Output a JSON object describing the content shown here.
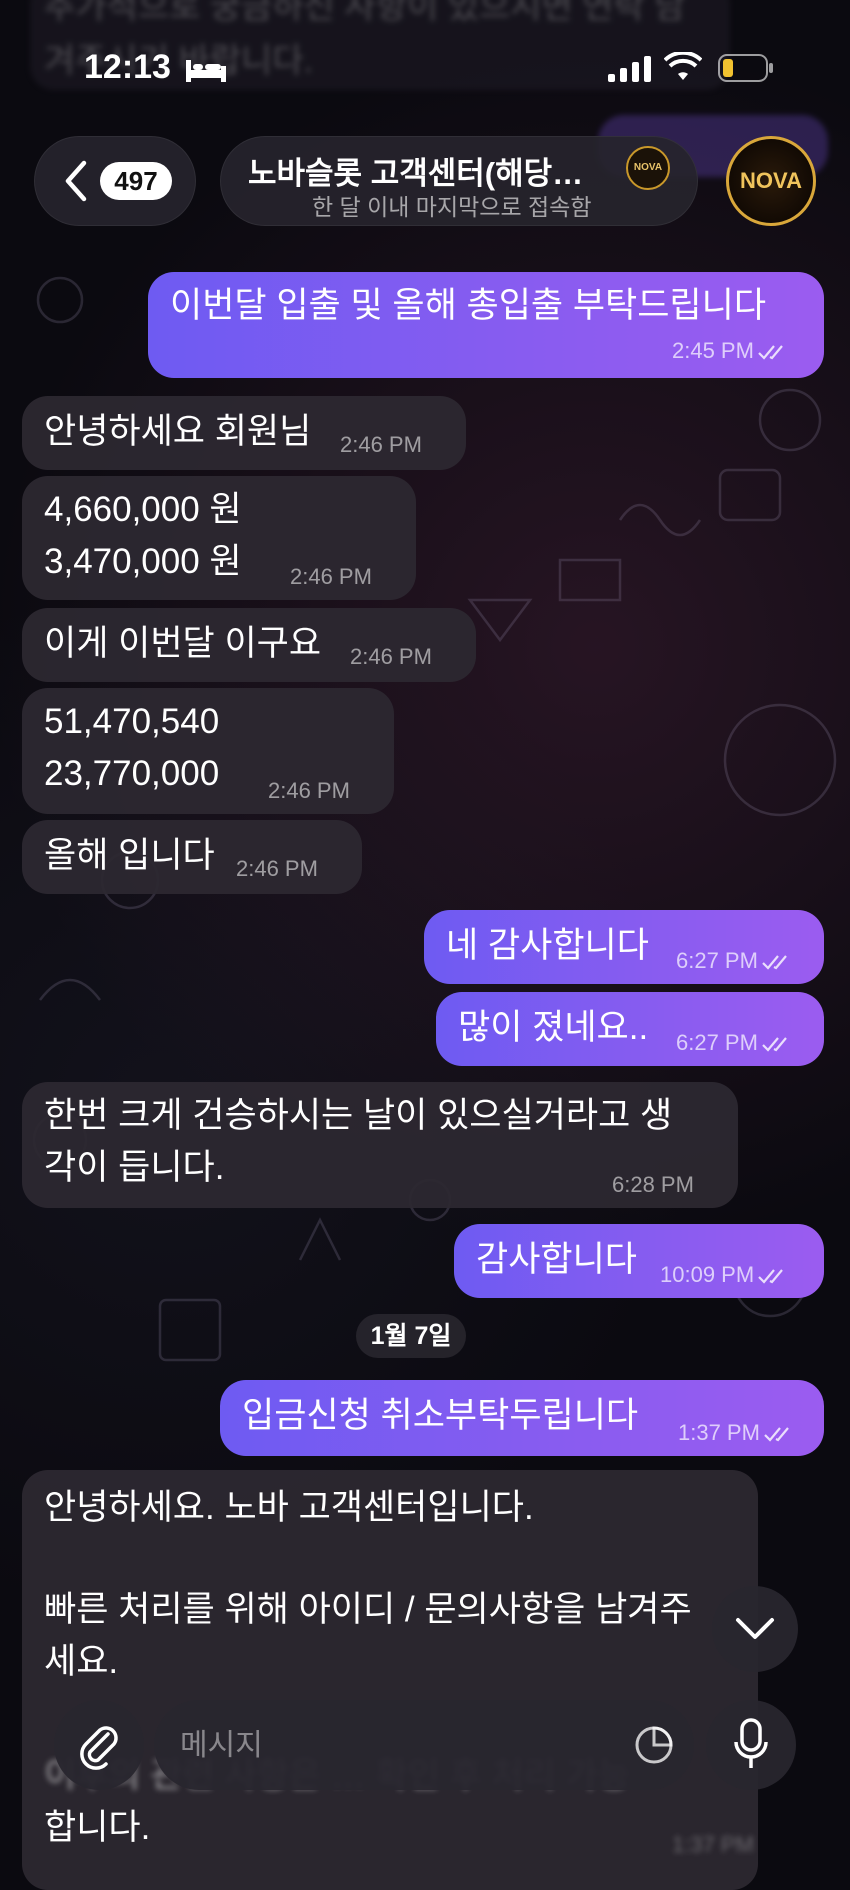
{
  "status_bar": {
    "time": "12:13"
  },
  "header": {
    "back_count": "497",
    "chat_title": "노바슬롯 고객센터(해당…",
    "chat_subtitle": "한 달 이내 마지막으로 접속함",
    "logo_text": "NOVA",
    "avatar_text": "NOVA"
  },
  "background_ghost": {
    "top_text": "추가적으로 궁금하신 사항이 있으시면 연락 남겨주시기 바랍니다."
  },
  "messages": [
    {
      "dir": "out",
      "text": "이번달 입출 및 올해 총입출 부탁드립니다",
      "time": "2:45 PM"
    },
    {
      "dir": "in",
      "text": "안녕하세요 회원님",
      "time": "2:46 PM"
    },
    {
      "dir": "in",
      "line1": "4,660,000 원",
      "line2": "3,470,000 원",
      "time": "2:46 PM"
    },
    {
      "dir": "in",
      "text": "이게 이번달 이구요",
      "time": "2:46 PM"
    },
    {
      "dir": "in",
      "line1": "51,470,540",
      "line2": "23,770,000",
      "time": "2:46 PM"
    },
    {
      "dir": "in",
      "text": "올해 입니다",
      "time": "2:46 PM"
    },
    {
      "dir": "out",
      "text": "네 감사합니다",
      "time": "6:27 PM"
    },
    {
      "dir": "out",
      "text": "많이 졌네요..",
      "time": "6:27 PM"
    },
    {
      "dir": "in",
      "line1": "한번 크게 건승하시는 날이 있으실거라고 생",
      "line2": "각이 듭니다.",
      "time": "6:28 PM"
    },
    {
      "dir": "out",
      "text": "감사합니다",
      "time": "10:09 PM"
    },
    {
      "dir": "out",
      "text": "입금신청 취소부탁두립니다",
      "time": "1:37 PM"
    },
    {
      "dir": "in",
      "line1": "안녕하세요. 노바 고객센터입니다.",
      "line2": "빠른 처리를 위해 아이디 / 문의사항을 남겨주",
      "line3": "세요.",
      "line4": "이후의 관련 사항은 … 확인 후 처리 가능",
      "line5": "합니다.",
      "time": "1:37 PM"
    }
  ],
  "date_separator": "1월 7일",
  "composer": {
    "placeholder": "메시지"
  },
  "colors": {
    "outgoing_start": "#6e5bf2",
    "outgoing_end": "#9b5cf0",
    "incoming": "#2c2830",
    "background": "#0b0a10"
  },
  "icons": [
    "bed-icon",
    "signal-icon",
    "wifi-icon",
    "battery-icon",
    "chevron-left-icon",
    "double-check-icon",
    "chevron-down-icon",
    "paperclip-icon",
    "sticker-icon",
    "microphone-icon"
  ]
}
